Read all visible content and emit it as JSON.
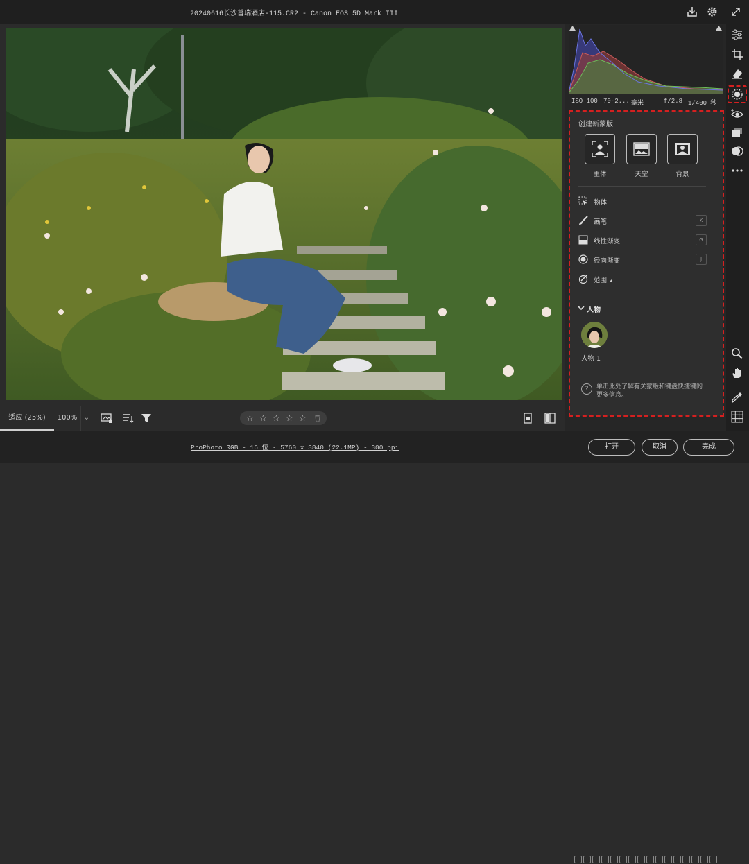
{
  "header": {
    "title": "20240616长沙普瑞酒店-115.CR2 -  Canon EOS 5D Mark III"
  },
  "histogram": {
    "exif": {
      "iso": "ISO 100",
      "focal": "70-2...",
      "focal_unit": "毫米",
      "aperture": "f/2.8",
      "shutter": "1/400 秒"
    }
  },
  "mask_panel": {
    "create_header": "创建新蒙版",
    "quick_buttons": [
      {
        "label": "主体",
        "icon": "subject-icon"
      },
      {
        "label": "天空",
        "icon": "sky-icon"
      },
      {
        "label": "背景",
        "icon": "background-icon"
      }
    ],
    "tools": [
      {
        "label": "物体",
        "icon": "object-select-icon",
        "key": ""
      },
      {
        "label": "画笔",
        "icon": "brush-icon",
        "key": "K"
      },
      {
        "label": "线性渐变",
        "icon": "linear-gradient-icon",
        "key": "G"
      },
      {
        "label": "径向渐变",
        "icon": "radial-gradient-icon",
        "key": "J"
      },
      {
        "label": "范围",
        "icon": "range-icon",
        "key": ""
      }
    ],
    "people_section": "人物",
    "person_label": "人物 1",
    "help_text": "单击此处了解有关蒙版和键盘快捷键的更多信息。"
  },
  "bottom_toolbar": {
    "zoom_fit": "适应 (25%)",
    "zoom_100": "100%",
    "chevron": "⌄",
    "stars": [
      "☆",
      "☆",
      "☆",
      "☆",
      "☆"
    ],
    "rating_value": 0
  },
  "footer": {
    "file_info": "ProPhoto RGB - 16 位 - 5760 x 3840 (22.1MP) - 300 ppi",
    "open_button": "打开",
    "cancel_button": "取消",
    "done_button": "完成"
  },
  "colors": {
    "highlight": "#d42020",
    "panel_bg": "#2e2e2e",
    "app_bg": "#2b2b2b"
  }
}
